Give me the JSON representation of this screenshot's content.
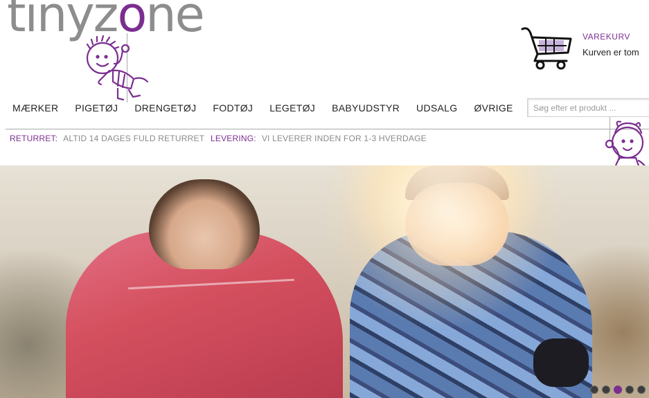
{
  "header": {
    "logo": {
      "part1": "tinyz",
      "part2": "o",
      "part3": "ne"
    }
  },
  "cart": {
    "title": "VAREKURV",
    "status": "Kurven er tom",
    "icon": "shopping-cart-icon"
  },
  "nav": {
    "items": [
      "MÆRKER",
      "PIGETØJ",
      "DRENGETØJ",
      "FODTØJ",
      "LEGETØJ",
      "BABYUDSTYR",
      "UDSALG",
      "ØVRIGE"
    ]
  },
  "search": {
    "placeholder": "Søg efter et produkt ..."
  },
  "infobar": {
    "return_label": "RETURRET:",
    "return_text": "ALTID 14 DAGES FULD RETURRET",
    "delivery_label": "LEVERING:",
    "delivery_text": "VI LEVERER INDEN FOR 1-3 HVERDAGE"
  },
  "slider": {
    "dot_count": 5,
    "active_index": 3
  },
  "colors": {
    "accent": "#7b2e8f",
    "text": "#222222",
    "muted": "#8a8a8a"
  }
}
